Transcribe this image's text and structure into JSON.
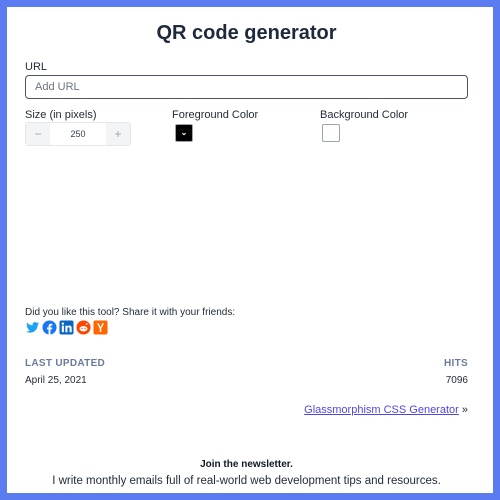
{
  "header": {
    "title": "QR code generator"
  },
  "url_field": {
    "label": "URL",
    "placeholder": "Add URL",
    "value": ""
  },
  "size_field": {
    "label": "Size (in pixels)",
    "value": "250",
    "decrement": "−",
    "increment": "+"
  },
  "foreground": {
    "label": "Foreground Color",
    "color": "#000000"
  },
  "background": {
    "label": "Background Color",
    "color": "#ffffff"
  },
  "share": {
    "text": "Did you like this tool? Share it with your friends:",
    "icons": [
      "twitter-icon",
      "facebook-icon",
      "linkedin-icon",
      "reddit-icon",
      "hacker-news-icon"
    ]
  },
  "meta": {
    "last_updated_label": "LAST UPDATED",
    "last_updated_value": "April 25, 2021",
    "hits_label": "HITS",
    "hits_value": "7096"
  },
  "next_link": {
    "label": "Glassmorphism CSS Generator",
    "arrow": "»"
  },
  "newsletter": {
    "title": "Join the newsletter.",
    "description": "I write monthly emails full of real-world web development tips and resources."
  },
  "colors": {
    "accent_border": "#5b7cf0",
    "link": "#4f46e5",
    "muted_heading": "#6b7a99"
  }
}
